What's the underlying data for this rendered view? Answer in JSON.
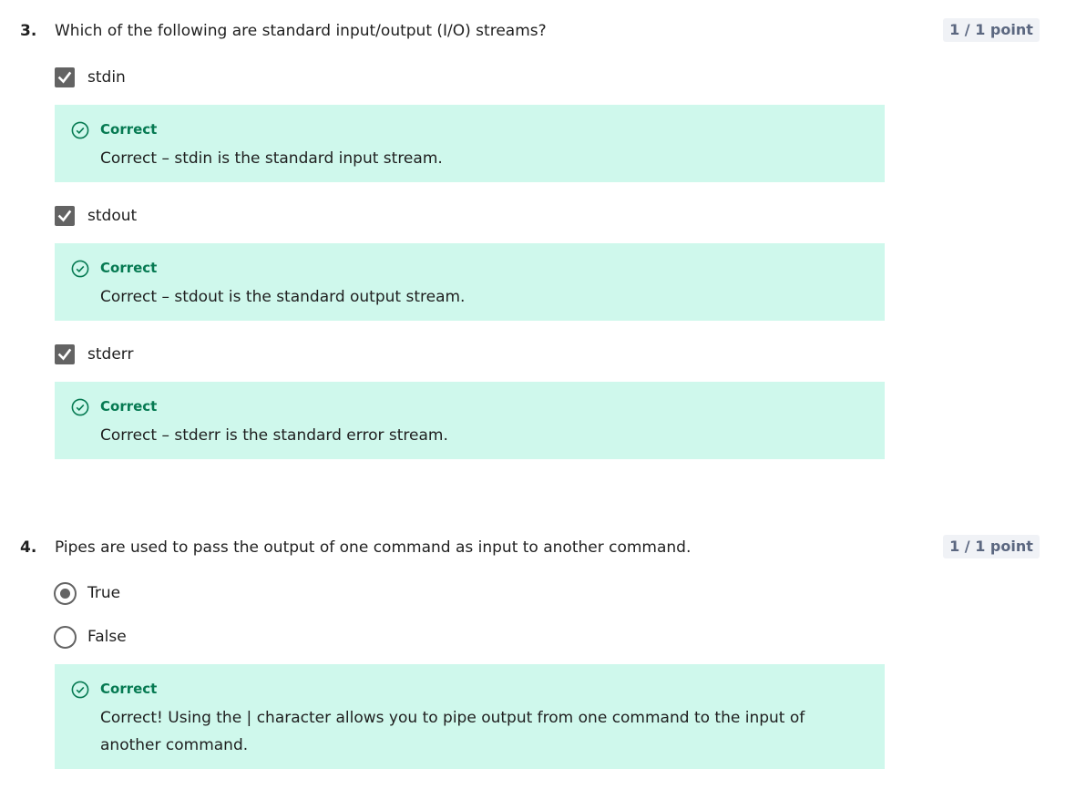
{
  "colors": {
    "feedback_bg": "#cff8ec",
    "feedback_title": "#067a52",
    "points_bg": "#f0f2f6",
    "points_text": "#5b6780",
    "control": "#636363"
  },
  "icons": {
    "feedback": "check-circle-icon",
    "checkbox": "checkmark-icon"
  },
  "questions": [
    {
      "number": "3.",
      "text": "Which of the following are standard input/output (I/O) streams?",
      "points": "1 / 1 point",
      "options": [
        {
          "label": "stdin",
          "checked": true,
          "feedback": {
            "title": "Correct",
            "text": "Correct – stdin is the standard input stream."
          }
        },
        {
          "label": "stdout",
          "checked": true,
          "feedback": {
            "title": "Correct",
            "text": "Correct – stdout is the standard output stream."
          }
        },
        {
          "label": "stderr",
          "checked": true,
          "feedback": {
            "title": "Correct",
            "text": "Correct – stderr is the standard error stream."
          }
        }
      ]
    },
    {
      "number": "4.",
      "text": "Pipes are used to pass the output of one command as input to another command.",
      "points": "1 / 1 point",
      "options": [
        {
          "label": "True",
          "selected": true
        },
        {
          "label": "False",
          "selected": false
        }
      ],
      "feedback": {
        "title": "Correct",
        "text": "Correct! Using the | character allows you to pipe output from one command to the input of another command."
      }
    }
  ]
}
